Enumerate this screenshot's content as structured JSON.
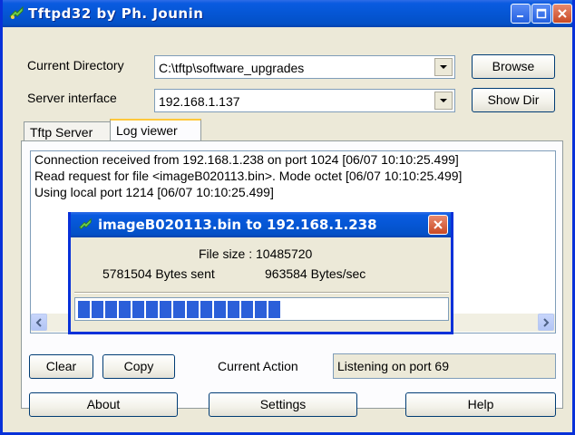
{
  "window": {
    "title": "Tftpd32 by Ph. Jounin",
    "colors": {
      "titlebar": "#0556d4",
      "close": "#c94a24",
      "progress": "#2b5fd9"
    }
  },
  "form": {
    "current_directory_label": "Current Directory",
    "current_directory_value": "C:\\tftp\\software_upgrades",
    "server_interface_label": "Server interface",
    "server_interface_value": "192.168.1.137",
    "browse_label": "Browse",
    "showdir_label": "Show Dir"
  },
  "tabs": [
    {
      "label": "Tftp Server",
      "active": false
    },
    {
      "label": "Log viewer",
      "active": true
    }
  ],
  "log": [
    "Connection received from 192.168.1.238 on port 1024 [06/07 10:10:25.499]",
    "Read request for file <imageB020113.bin>. Mode octet [06/07 10:10:25.499]",
    "Using local port 1214 [06/07 10:10:25.499]"
  ],
  "transfer_dialog": {
    "title": "imageB020113.bin to 192.168.1.238",
    "file_size": "File size : 10485720",
    "bytes_sent": "5781504 Bytes sent",
    "rate": "963584 Bytes/sec",
    "progress_fraction": 0.55
  },
  "actions": {
    "clear_label": "Clear",
    "copy_label": "Copy",
    "current_action_label": "Current Action",
    "current_action_value": "Listening on port 69"
  },
  "bottom": {
    "about_label": "About",
    "settings_label": "Settings",
    "help_label": "Help"
  }
}
